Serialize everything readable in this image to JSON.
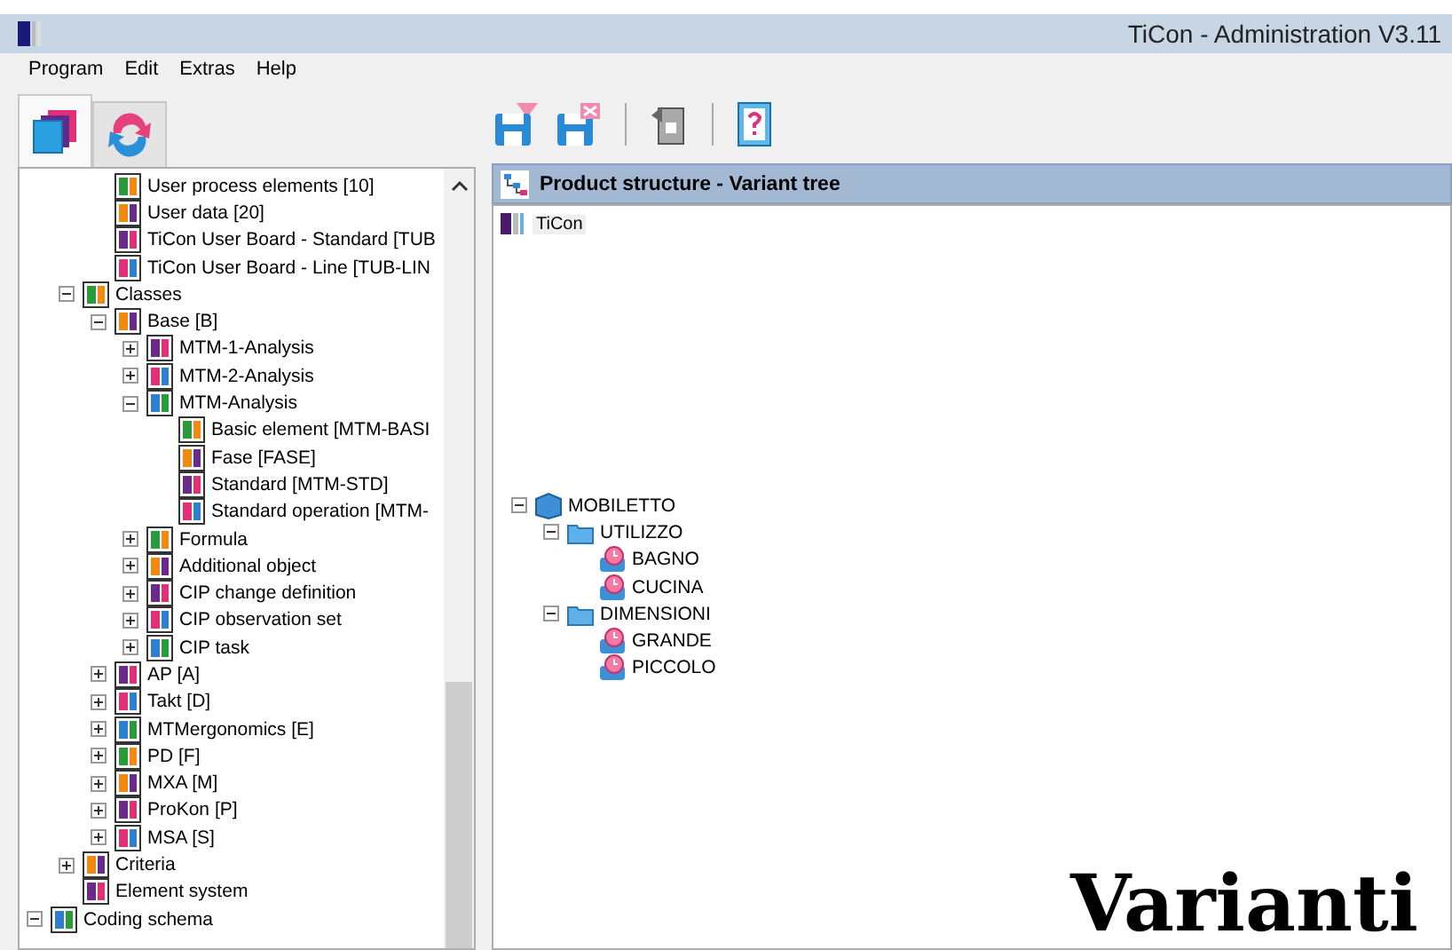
{
  "window": {
    "title": "TiCon - Administration V3.11"
  },
  "menu": [
    "Program",
    "Edit",
    "Extras",
    "Help"
  ],
  "tabs": [
    {
      "selected": true
    },
    {
      "selected": false
    }
  ],
  "tree": [
    {
      "children": [
        {
          "children": [
            {
              "label": "User process elements [10]"
            },
            {
              "label": "User data [20]"
            },
            {
              "label": "TiCon User Board - Standard [TUB"
            },
            {
              "label": "TiCon User Board - Line [TUB-LIN"
            }
          ]
        },
        {
          "label": "Classes",
          "expanded": true,
          "children": [
            {
              "label": "Base [B]",
              "expanded": true,
              "children": [
                {
                  "label": "MTM-1-Analysis",
                  "expanded": false
                },
                {
                  "label": "MTM-2-Analysis",
                  "expanded": false
                },
                {
                  "label": "MTM-Analysis",
                  "expanded": true,
                  "children": [
                    {
                      "label": "Basic element [MTM-BASI"
                    },
                    {
                      "label": "Fase [FASE]"
                    },
                    {
                      "label": "Standard [MTM-STD]"
                    },
                    {
                      "label": "Standard operation [MTM-"
                    }
                  ]
                },
                {
                  "label": "Formula",
                  "expanded": false
                },
                {
                  "label": "Additional object",
                  "expanded": false
                },
                {
                  "label": "CIP change definition",
                  "expanded": false
                },
                {
                  "label": "CIP observation set",
                  "expanded": false
                },
                {
                  "label": "CIP task",
                  "expanded": false
                }
              ]
            },
            {
              "label": "AP [A]",
              "expanded": false
            },
            {
              "label": "Takt [D]",
              "expanded": false
            },
            {
              "label": "MTMergonomics [E]",
              "expanded": false
            },
            {
              "label": "PD [F]",
              "expanded": false
            },
            {
              "label": "MXA [M]",
              "expanded": false
            },
            {
              "label": "ProKon [P]",
              "expanded": false
            },
            {
              "label": "MSA [S]",
              "expanded": false
            }
          ]
        },
        {
          "label": "Criteria",
          "expanded": false
        },
        {
          "label": "Element system"
        }
      ]
    },
    {
      "label": "Coding schema",
      "expanded": true
    }
  ],
  "panel": {
    "title": "Product structure - Variant tree",
    "root": {
      "label": "TiCon",
      "selected": true
    }
  },
  "variant_tree": [
    {
      "label": "MOBILETTO",
      "expanded": true,
      "children": [
        {
          "label": "UTILIZZO",
          "expanded": true,
          "children": [
            {
              "label": "BAGNO"
            },
            {
              "label": "CUCINA"
            }
          ]
        },
        {
          "label": "DIMENSIONI",
          "expanded": true,
          "children": [
            {
              "label": "GRANDE"
            },
            {
              "label": "PICCOLO"
            }
          ]
        }
      ]
    }
  ],
  "caption": "Varianti"
}
